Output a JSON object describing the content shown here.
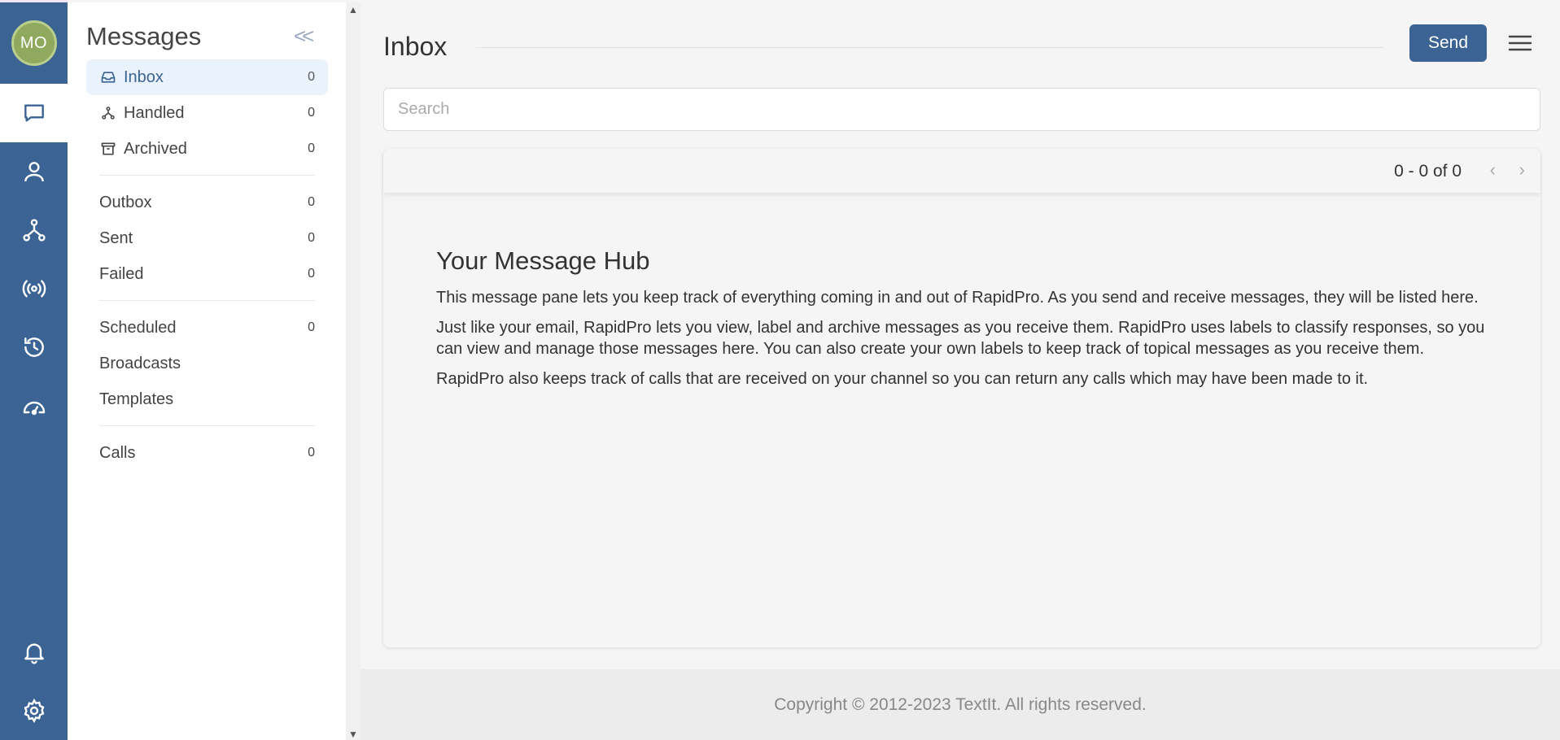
{
  "rail": {
    "avatar_initials": "MO",
    "items": [
      {
        "icon": "message-icon",
        "active": true
      },
      {
        "icon": "contacts-icon",
        "active": false
      },
      {
        "icon": "flows-icon",
        "active": false
      },
      {
        "icon": "channels-icon",
        "active": false
      },
      {
        "icon": "history-icon",
        "active": false
      },
      {
        "icon": "dashboard-icon",
        "active": false
      }
    ],
    "bottom_items": [
      {
        "icon": "bell-icon"
      },
      {
        "icon": "gear-icon"
      }
    ]
  },
  "sidebar": {
    "title": "Messages",
    "collapse_glyph": "<<",
    "inbox": {
      "label": "Inbox",
      "count": "0"
    },
    "handled": {
      "label": "Handled",
      "count": "0"
    },
    "archived": {
      "label": "Archived",
      "count": "0"
    },
    "outbox": {
      "label": "Outbox",
      "count": "0"
    },
    "sent": {
      "label": "Sent",
      "count": "0"
    },
    "failed": {
      "label": "Failed",
      "count": "0"
    },
    "scheduled": {
      "label": "Scheduled",
      "count": "0"
    },
    "broadcasts": {
      "label": "Broadcasts"
    },
    "templates": {
      "label": "Templates"
    },
    "calls": {
      "label": "Calls",
      "count": "0"
    }
  },
  "main": {
    "title": "Inbox",
    "send_label": "Send",
    "search_placeholder": "Search",
    "pager": "0 - 0 of 0",
    "hub": {
      "heading": "Your Message Hub",
      "p1": "This message pane lets you keep track of everything coming in and out of RapidPro. As you send and receive messages, they will be listed here.",
      "p2": "Just like your email, RapidPro lets you view, label and archive messages as you receive them. RapidPro uses labels to classify responses, so you can view and manage those messages here. You can also create your own labels to keep track of topical messages as you receive them.",
      "p3": "RapidPro also keeps track of calls that are received on your channel so you can return any calls which may have been made to it."
    },
    "footer": "Copyright © 2012-2023 TextIt. All rights reserved."
  },
  "colors": {
    "accent": "#3b6494",
    "active_bg": "#eaf2fb"
  }
}
